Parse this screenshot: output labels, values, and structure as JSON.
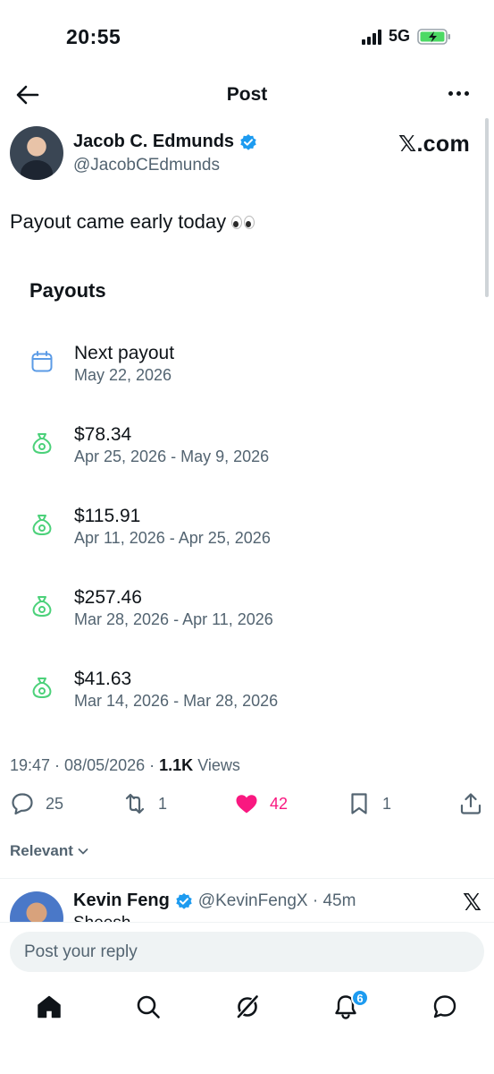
{
  "status_bar": {
    "time": "20:55",
    "network": "5G"
  },
  "header": {
    "title": "Post"
  },
  "author": {
    "name": "Jacob C. Edmunds",
    "handle": "@JacobCEdmunds",
    "source_label": "𝕏.com"
  },
  "tweet": {
    "text": "Payout came early today"
  },
  "payouts": {
    "heading": "Payouts",
    "next": {
      "title": "Next payout",
      "date": "May 22, 2026"
    },
    "items": [
      {
        "amount": "$78.34",
        "range": "Apr 25, 2026 - May 9, 2026"
      },
      {
        "amount": "$115.91",
        "range": "Apr 11, 2026 - Apr 25, 2026"
      },
      {
        "amount": "$257.46",
        "range": "Mar 28, 2026 - Apr 11, 2026"
      },
      {
        "amount": "$41.63",
        "range": "Mar 14, 2026 - Mar 28, 2026"
      }
    ]
  },
  "meta": {
    "time": "19:47",
    "date": "08/05/2026",
    "views_count": "1.1K",
    "views_label": "Views"
  },
  "actions": {
    "replies": "25",
    "reposts": "1",
    "likes": "42",
    "bookmarks": "1"
  },
  "filter": {
    "label": "Relevant"
  },
  "reply_preview": {
    "name": "Kevin Feng",
    "handle": "@KevinFengX · 45m",
    "snippet": "Sheesh"
  },
  "composer": {
    "placeholder": "Post your reply"
  },
  "nav": {
    "notification_count": "6"
  },
  "colors": {
    "accent": "#1d9bf0",
    "like": "#f91880",
    "payout_icon": "#4cd17a",
    "calendar_icon": "#5b9be6"
  }
}
